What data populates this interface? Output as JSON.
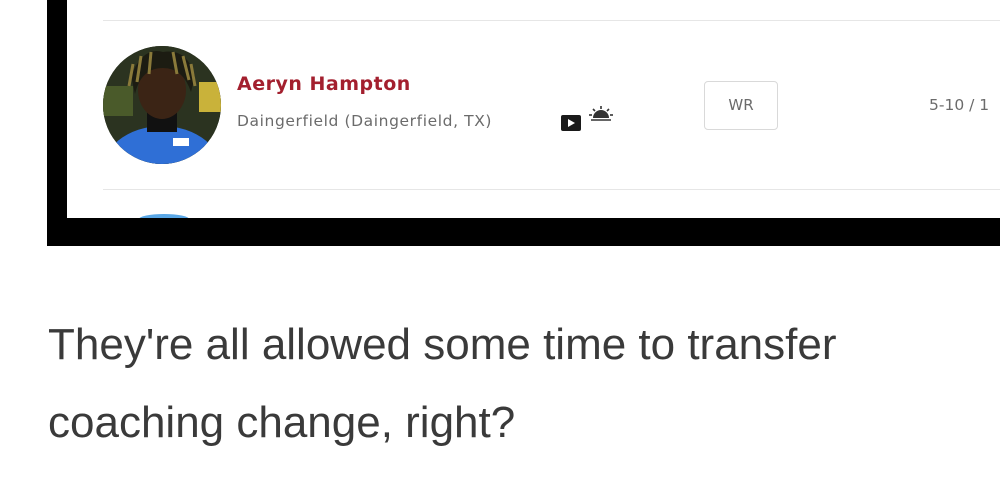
{
  "player": {
    "name": "Aeryn Hampton",
    "school": "Daingerfield (Daingerfield, TX)",
    "position": "WR",
    "height_weight": "5-10 / 1"
  },
  "icons": {
    "video": "video-play-icon",
    "rating": "sun-rating-icon"
  },
  "caption": {
    "line1": "They're all allowed some time to transfer",
    "line2": "coaching change, right?"
  },
  "colors": {
    "name": "#a31f2e",
    "secondary_text": "#6b6b6b",
    "caption_text": "#3a3a3a",
    "frame": "#000000"
  }
}
